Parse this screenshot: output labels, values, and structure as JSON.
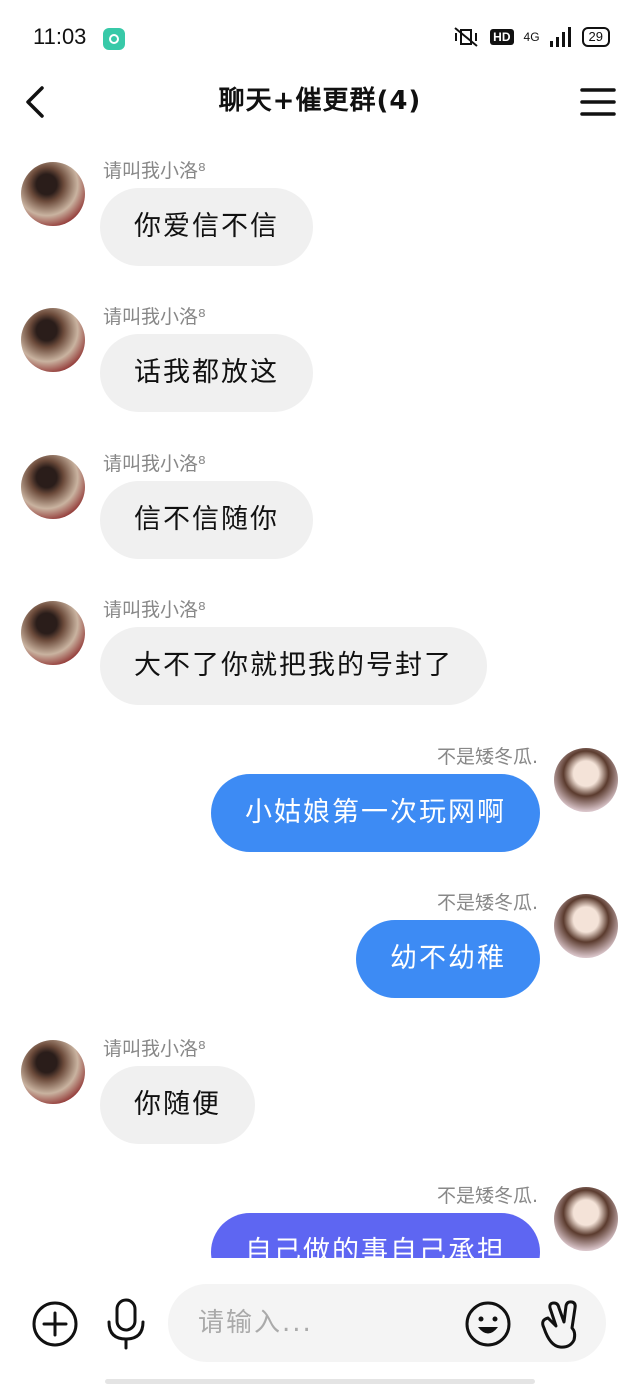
{
  "status_bar": {
    "time": "11:03",
    "hd": "HD",
    "network": "4G",
    "battery": "29"
  },
  "header": {
    "title": "聊天+催更群(4)",
    "back_icon": "chevron-left-icon",
    "menu_icon": "hamburger-menu-icon"
  },
  "messages": [
    {
      "side": "left",
      "sender": "请叫我小洛⁸",
      "text": "你爱信不信"
    },
    {
      "side": "left",
      "sender": "请叫我小洛⁸",
      "text": "话我都放这"
    },
    {
      "side": "left",
      "sender": "请叫我小洛⁸",
      "text": "信不信随你"
    },
    {
      "side": "left",
      "sender": "请叫我小洛⁸",
      "text": "大不了你就把我的号封了"
    },
    {
      "side": "right",
      "sender": "不是矮冬瓜.",
      "text": "小姑娘第一次玩网啊"
    },
    {
      "side": "right",
      "sender": "不是矮冬瓜.",
      "text": "幼不幼稚"
    },
    {
      "side": "left",
      "sender": "请叫我小洛⁸",
      "text": "你随便"
    },
    {
      "side": "right",
      "sender": "不是矮冬瓜.",
      "text": "自己做的事自己承担"
    }
  ],
  "input": {
    "placeholder": "请输入..."
  },
  "colors": {
    "bubble_sent": "#3d8bf4",
    "bubble_sent_last": "#5e66f2",
    "bubble_received": "#f0f0f0"
  }
}
